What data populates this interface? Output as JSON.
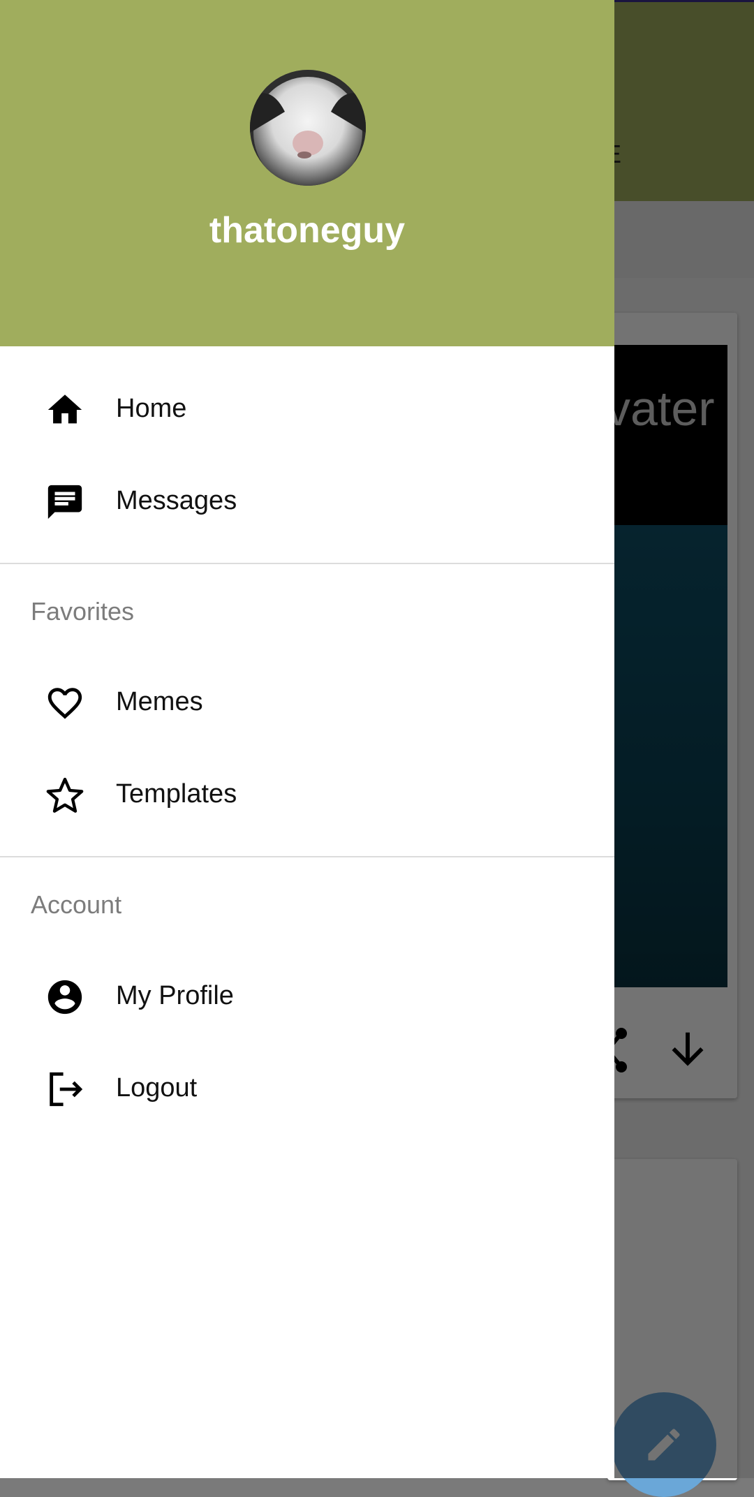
{
  "drawer": {
    "username": "thatoneguy",
    "main_items": [
      {
        "label": "Home",
        "icon": "home-icon"
      },
      {
        "label": "Messages",
        "icon": "message-icon"
      }
    ],
    "favorites": {
      "title": "Favorites",
      "items": [
        {
          "label": "Memes",
          "icon": "heart-outline-icon"
        },
        {
          "label": "Templates",
          "icon": "star-outline-icon"
        }
      ]
    },
    "account": {
      "title": "Account",
      "items": [
        {
          "label": "My Profile",
          "icon": "account-circle-icon"
        },
        {
          "label": "Logout",
          "icon": "logout-icon"
        }
      ]
    },
    "header_color": "#a0ad5d"
  },
  "background": {
    "tab_fragment": "TE",
    "meme_text_fragment": "vater",
    "accent_color": "#a0ad5d",
    "fab_color": "#6aa7d8"
  }
}
